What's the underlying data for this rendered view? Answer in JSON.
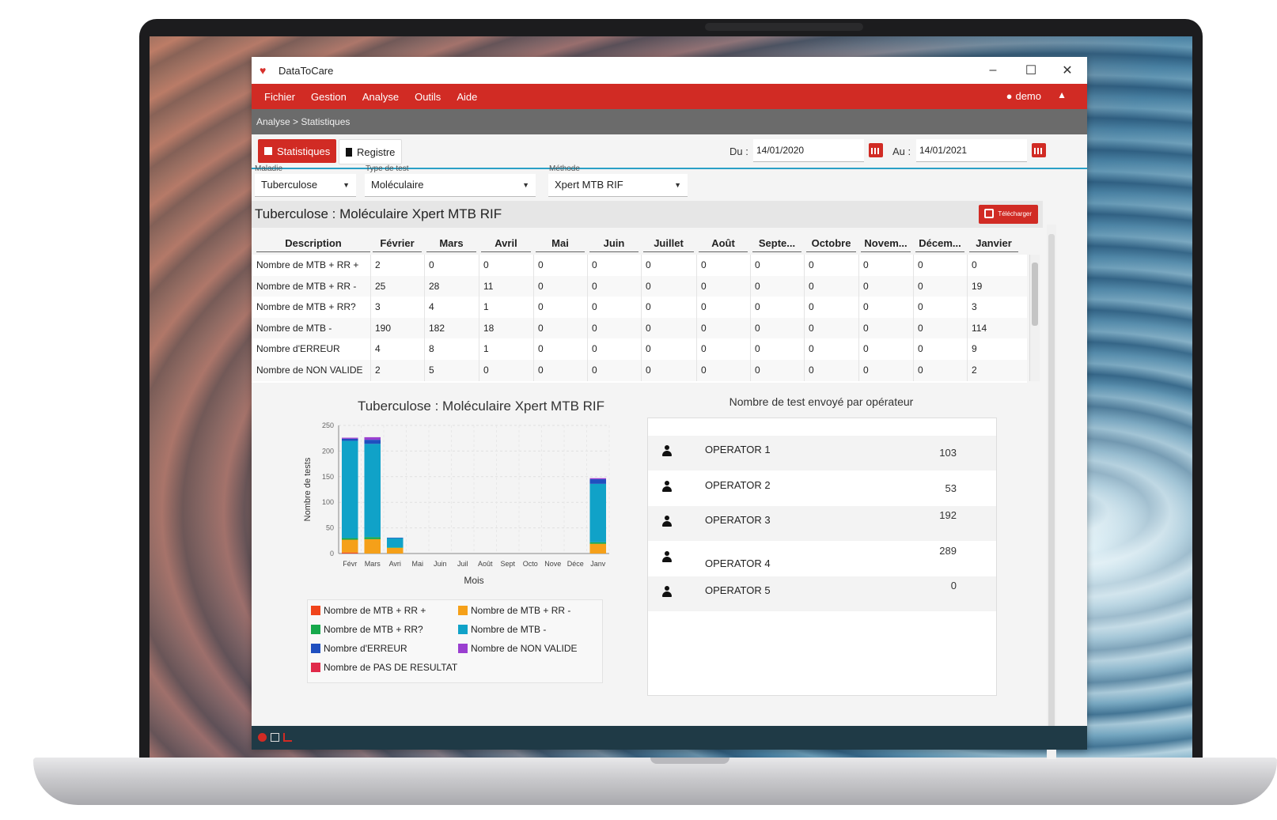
{
  "app": {
    "title": "DataToCare"
  },
  "window_controls": {
    "minimize": "–",
    "maximize": "☐",
    "close": "✕"
  },
  "menu": {
    "items": [
      "Fichier",
      "Gestion",
      "Analyse",
      "Outils",
      "Aide"
    ],
    "user": "demo"
  },
  "breadcrumb": "Analyse > Statistiques",
  "toolbar": {
    "tab_stats": "Statistiques",
    "tab_registre": "Registre",
    "du_label": "Du :",
    "du_value": "14/01/2020",
    "au_label": "Au :",
    "au_value": "14/01/2021"
  },
  "filters": {
    "maladie_label": "Maladie",
    "maladie_value": "Tuberculose",
    "type_label": "Type de test",
    "type_value": "Moléculaire",
    "methode_label": "Méthode",
    "methode_value": "Xpert MTB RIF"
  },
  "section": {
    "title": "Tuberculose : Moléculaire Xpert MTB RIF",
    "download_label": "Télécharger"
  },
  "table": {
    "headers": [
      "Description",
      "Février",
      "Mars",
      "Avril",
      "Mai",
      "Juin",
      "Juillet",
      "Août",
      "Septe...",
      "Octobre",
      "Novem...",
      "Décem...",
      "Janvier"
    ],
    "rows": [
      [
        "Nombre de MTB + RR +",
        "2",
        "0",
        "0",
        "0",
        "0",
        "0",
        "0",
        "0",
        "0",
        "0",
        "0",
        "0"
      ],
      [
        "Nombre de MTB + RR -",
        "25",
        "28",
        "11",
        "0",
        "0",
        "0",
        "0",
        "0",
        "0",
        "0",
        "0",
        "19"
      ],
      [
        "Nombre de MTB + RR?",
        "3",
        "4",
        "1",
        "0",
        "0",
        "0",
        "0",
        "0",
        "0",
        "0",
        "0",
        "3"
      ],
      [
        "Nombre de MTB -",
        "190",
        "182",
        "18",
        "0",
        "0",
        "0",
        "0",
        "0",
        "0",
        "0",
        "0",
        "114"
      ],
      [
        "Nombre d'ERREUR",
        "4",
        "8",
        "1",
        "0",
        "0",
        "0",
        "0",
        "0",
        "0",
        "0",
        "0",
        "9"
      ],
      [
        "Nombre de NON VALIDE",
        "2",
        "5",
        "0",
        "0",
        "0",
        "0",
        "0",
        "0",
        "0",
        "0",
        "0",
        "2"
      ]
    ]
  },
  "chart_data": {
    "type": "bar",
    "stacked": true,
    "title": "Tuberculose : Moléculaire Xpert MTB RIF",
    "xlabel": "Mois",
    "ylabel": "Nombre de tests",
    "ylim": [
      0,
      250
    ],
    "yticks": [
      0,
      50,
      100,
      150,
      200,
      250
    ],
    "grid": true,
    "legend_position": "bottom",
    "categories": [
      "Févr",
      "Mars",
      "Avri",
      "Mai",
      "Juin",
      "Juil",
      "Août",
      "Sept",
      "Octo",
      "Nove",
      "Déce",
      "Janv"
    ],
    "series": [
      {
        "name": "Nombre de MTB + RR +",
        "color": "#f0441b",
        "values": [
          2,
          0,
          0,
          0,
          0,
          0,
          0,
          0,
          0,
          0,
          0,
          0
        ]
      },
      {
        "name": "Nombre de MTB + RR -",
        "color": "#f5a019",
        "values": [
          25,
          28,
          11,
          0,
          0,
          0,
          0,
          0,
          0,
          0,
          0,
          19
        ]
      },
      {
        "name": "Nombre de MTB + RR?",
        "color": "#16a84b",
        "values": [
          3,
          4,
          1,
          0,
          0,
          0,
          0,
          0,
          0,
          0,
          0,
          3
        ]
      },
      {
        "name": "Nombre de MTB -",
        "color": "#10a2c8",
        "values": [
          190,
          182,
          18,
          0,
          0,
          0,
          0,
          0,
          0,
          0,
          0,
          114
        ]
      },
      {
        "name": "Nombre d'ERREUR",
        "color": "#1f4fbf",
        "values": [
          4,
          8,
          1,
          0,
          0,
          0,
          0,
          0,
          0,
          0,
          0,
          9
        ]
      },
      {
        "name": "Nombre de NON VALIDE",
        "color": "#9a3fd0",
        "values": [
          2,
          5,
          0,
          0,
          0,
          0,
          0,
          0,
          0,
          0,
          0,
          2
        ]
      },
      {
        "name": "Nombre de PAS DE RESULTAT",
        "color": "#e02a4a",
        "values": [
          0,
          0,
          0,
          0,
          0,
          0,
          0,
          0,
          0,
          0,
          0,
          0
        ]
      }
    ]
  },
  "operators": {
    "title": "Nombre de test envoyé par opérateur",
    "list": [
      {
        "name": "OPERATOR 1",
        "count": "103"
      },
      {
        "name": "OPERATOR 2",
        "count": "53"
      },
      {
        "name": "OPERATOR 3",
        "count": "192"
      },
      {
        "name": "OPERATOR 4",
        "count": "289"
      },
      {
        "name": "OPERATOR 5",
        "count": "0"
      }
    ]
  },
  "colors": {
    "accent": "#d12b24",
    "statusbar": "#1f3a46",
    "breadcrumb": "#6b6b6b"
  }
}
